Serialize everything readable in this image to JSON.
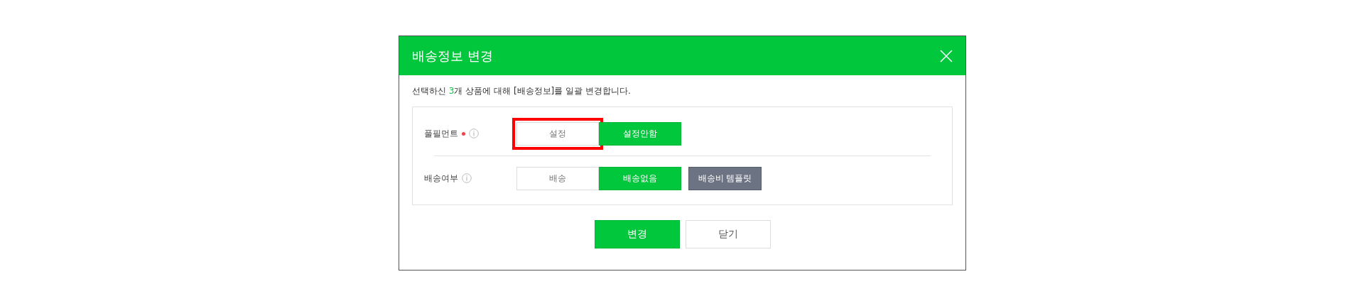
{
  "dialog": {
    "title": "배송정보 변경"
  },
  "description": {
    "before": "선택하신 ",
    "count": "3",
    "after": "개 상품에 대해 [배송정보]를 일괄 변경합니다."
  },
  "rows": [
    {
      "label": "풀필먼트",
      "required": true,
      "options": [
        {
          "label": "설정",
          "selected": false,
          "highlighted": true
        },
        {
          "label": "설정안함",
          "selected": true,
          "highlighted": false
        }
      ]
    },
    {
      "label": "배송여부",
      "required": false,
      "options": [
        {
          "label": "배송",
          "selected": false,
          "highlighted": false
        },
        {
          "label": "배송없음",
          "selected": true,
          "highlighted": false
        }
      ],
      "extra_button": "배송비 템플릿"
    }
  ],
  "buttons": [
    {
      "label": "변경",
      "kind": "primary"
    },
    {
      "label": "닫기",
      "kind": "secondary"
    }
  ]
}
